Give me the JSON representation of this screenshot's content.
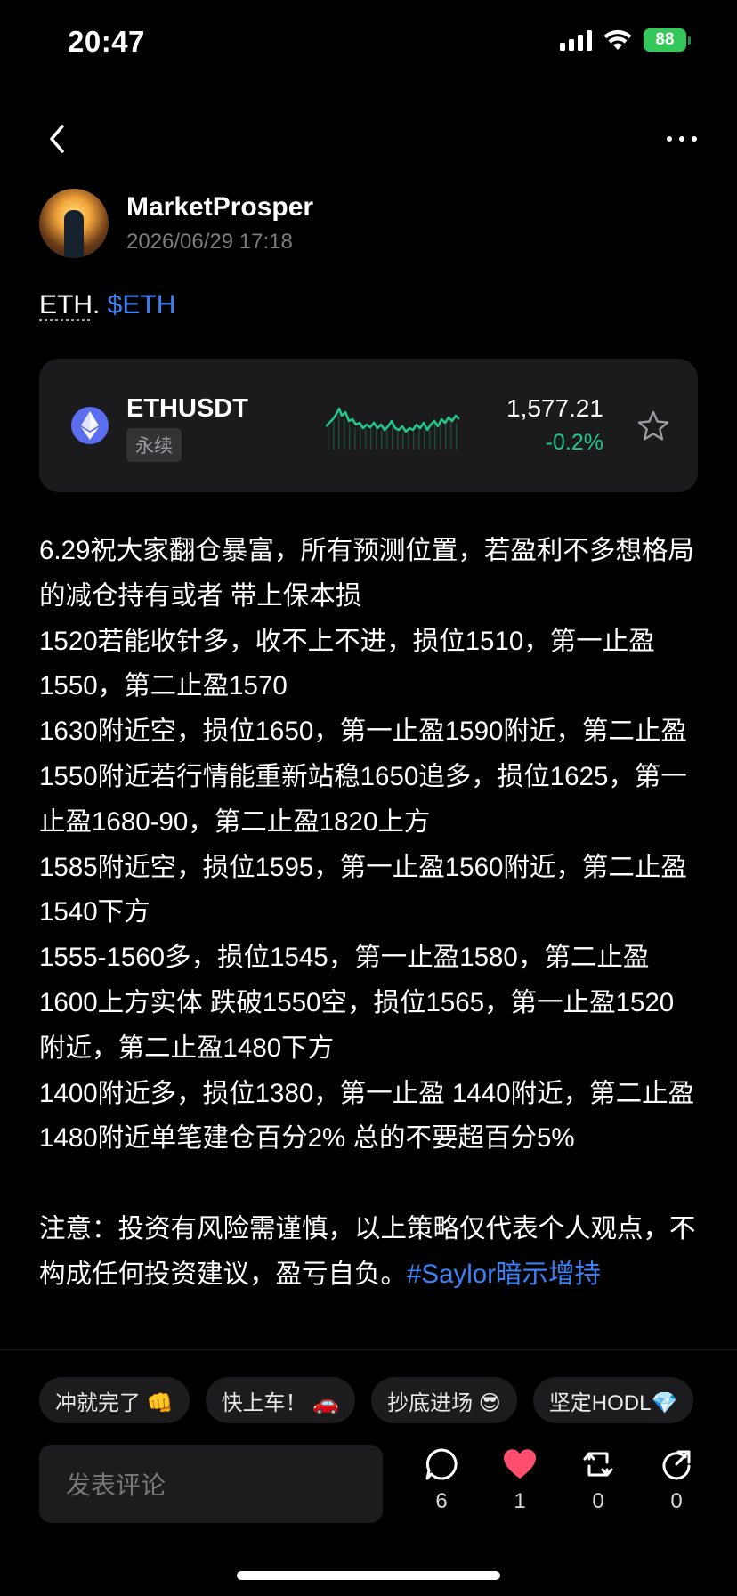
{
  "status_bar": {
    "time": "20:47",
    "battery": "88",
    "icons": [
      "signal-icon",
      "wifi-icon",
      "battery-icon"
    ]
  },
  "nav": {
    "back_icon": "chevron-left-icon",
    "more_icon": "more-horizontal-icon"
  },
  "author": {
    "name": "MarketProsper",
    "date": "2026/06/29 17:18"
  },
  "tags": {
    "plain": "ETH",
    "separator": ". ",
    "cashtag": "$ETH"
  },
  "ticker": {
    "symbol": "ETHUSDT",
    "badge": "永续",
    "price": "1,577.21",
    "change": "-0.2%",
    "change_color": "#22c58a",
    "icon": "ethereum-icon",
    "favorite_icon": "star-icon"
  },
  "post": {
    "lines": [
      "6.29祝大家翻仓暴富，所有预测位置，若盈利不多想格局的减仓持有或者 带上保本损",
      "1520若能收针多，收不上不进，损位1510，第一止盈1550，第二止盈1570",
      "1630附近空，损位1650，第一止盈1590附近，第二止盈1550附近若行情能重新站稳1650追多，损位1625，第一止盈1680-90，第二止盈1820上方",
      "1585附近空，损位1595，第一止盈1560附近，第二止盈1540下方",
      "1555-1560多，损位1545，第一止盈1580，第二止盈1600上方实体 跌破1550空，损位1565，第一止盈1520附近，第二止盈1480下方",
      "1400附近多，损位1380，第一止盈 1440附近，第二止盈1480附近单笔建仓百分2% 总的不要超百分5%"
    ],
    "disclaimer": "注意：投资有风险需谨慎，以上策略仅代表个人观点，不构成任何投资建议，盈亏自负。",
    "hashtag": "#Saylor暗示增持"
  },
  "quick_replies": [
    "冲就完了 👊",
    "快上车！ 🚗",
    "抄底进场 😎",
    "坚定HODL💎"
  ],
  "comment": {
    "placeholder": "发表评论"
  },
  "actions": [
    {
      "icon": "comment-icon",
      "count": "6"
    },
    {
      "icon": "heart-icon",
      "count": "1",
      "color": "#ff4d6d"
    },
    {
      "icon": "repost-icon",
      "count": "0"
    },
    {
      "icon": "share-icon",
      "count": "0"
    }
  ]
}
